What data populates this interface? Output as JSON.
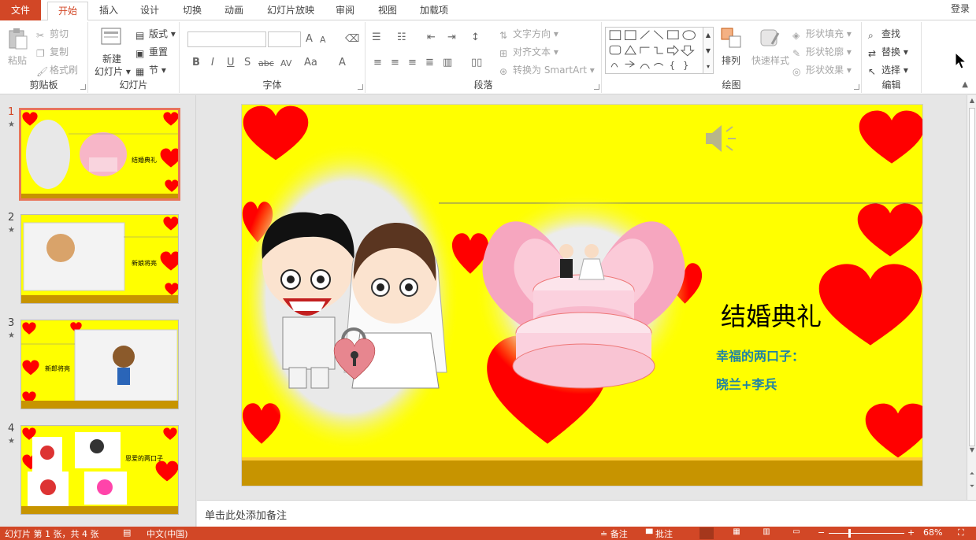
{
  "tabs": [
    "文件",
    "开始",
    "插入",
    "设计",
    "切换",
    "动画",
    "幻灯片放映",
    "审阅",
    "视图",
    "加载项"
  ],
  "login": "登录",
  "clipboard": {
    "paste": "粘贴",
    "cut": "剪切",
    "copy": "复制",
    "format_painter": "格式刷",
    "label": "剪贴板"
  },
  "slides_group": {
    "new_slide": "新建",
    "new_slide2": "幻灯片",
    "layout": "版式",
    "reset": "重置",
    "section": "节",
    "label": "幻灯片"
  },
  "font_group": {
    "label": "字体",
    "bold": "B",
    "italic": "I",
    "underline": "U",
    "shadow": "S",
    "strike": "abc",
    "spacing": "AV",
    "case": "Aa",
    "color": "A",
    "grow": "A",
    "shrink": "A"
  },
  "paragraph": {
    "text_direction": "文字方向",
    "align_text": "对齐文本",
    "smartart": "转换为 SmartArt",
    "label": "段落"
  },
  "drawing": {
    "arrange": "排列",
    "quick_styles": "快速样式",
    "fill": "形状填充",
    "outline": "形状轮廓",
    "effects": "形状效果",
    "label": "绘图"
  },
  "editing": {
    "find": "查找",
    "replace": "替换",
    "select": "选择",
    "label": "编辑"
  },
  "thumbnails": [
    {
      "num": "1",
      "text": "结婚典礼"
    },
    {
      "num": "2",
      "text": "新娘将亮"
    },
    {
      "num": "3",
      "text": "新郎将亮"
    },
    {
      "num": "4",
      "text": "恩爱的两口子"
    }
  ],
  "slide": {
    "title": "结婚典礼",
    "subtitle1": "幸福的两口子：",
    "subtitle2": "晓兰+李兵"
  },
  "notes_placeholder": "单击此处添加备注",
  "status": {
    "slide_info": "幻灯片 第 1 张，共 4 张",
    "language": "中文(中国)",
    "notes": "备注",
    "comments": "批注",
    "zoom": "68%"
  },
  "colors": {
    "accent": "#d24726",
    "slide_bg": "#ffff00",
    "heart": "#ff0000",
    "band": "#c79400",
    "subtitle": "#1d82a6"
  }
}
